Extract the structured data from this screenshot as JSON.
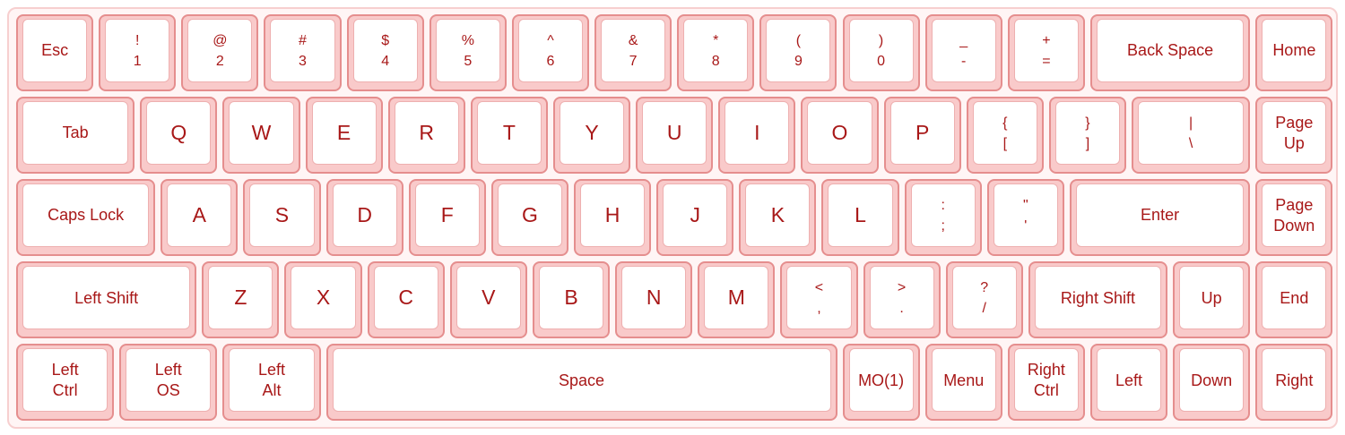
{
  "keyboard": {
    "rows": [
      [
        {
          "id": "esc",
          "lines": [
            "Esc"
          ],
          "w": 1
        },
        {
          "id": "1",
          "lines": [
            "!",
            "1"
          ],
          "w": 1
        },
        {
          "id": "2",
          "lines": [
            "@",
            "2"
          ],
          "w": 1
        },
        {
          "id": "3",
          "lines": [
            "#",
            "3"
          ],
          "w": 1
        },
        {
          "id": "4",
          "lines": [
            "$",
            "4"
          ],
          "w": 1
        },
        {
          "id": "5",
          "lines": [
            "%",
            "5"
          ],
          "w": 1
        },
        {
          "id": "6",
          "lines": [
            "^",
            "6"
          ],
          "w": 1
        },
        {
          "id": "7",
          "lines": [
            "&",
            "7"
          ],
          "w": 1
        },
        {
          "id": "8",
          "lines": [
            "*",
            "8"
          ],
          "w": 1
        },
        {
          "id": "9",
          "lines": [
            "(",
            "9"
          ],
          "w": 1
        },
        {
          "id": "0",
          "lines": [
            ")",
            "0"
          ],
          "w": 1
        },
        {
          "id": "minus",
          "lines": [
            "_",
            "-"
          ],
          "w": 1
        },
        {
          "id": "equals",
          "lines": [
            "+",
            "="
          ],
          "w": 1
        },
        {
          "id": "backspace",
          "lines": [
            "Back Space"
          ],
          "w": 2
        },
        {
          "id": "home",
          "lines": [
            "Home"
          ],
          "w": 1
        }
      ],
      [
        {
          "id": "tab",
          "lines": [
            "Tab"
          ],
          "w": 1.5
        },
        {
          "id": "q",
          "lines": [
            "Q"
          ],
          "w": 1
        },
        {
          "id": "w",
          "lines": [
            "W"
          ],
          "w": 1
        },
        {
          "id": "e",
          "lines": [
            "E"
          ],
          "w": 1
        },
        {
          "id": "r",
          "lines": [
            "R"
          ],
          "w": 1
        },
        {
          "id": "t",
          "lines": [
            "T"
          ],
          "w": 1
        },
        {
          "id": "y",
          "lines": [
            "Y"
          ],
          "w": 1
        },
        {
          "id": "u",
          "lines": [
            "U"
          ],
          "w": 1
        },
        {
          "id": "i",
          "lines": [
            "I"
          ],
          "w": 1
        },
        {
          "id": "o",
          "lines": [
            "O"
          ],
          "w": 1
        },
        {
          "id": "p",
          "lines": [
            "P"
          ],
          "w": 1
        },
        {
          "id": "lbracket",
          "lines": [
            "{",
            "["
          ],
          "w": 1
        },
        {
          "id": "rbracket",
          "lines": [
            "}",
            "]"
          ],
          "w": 1
        },
        {
          "id": "backslash",
          "lines": [
            "|",
            "\\"
          ],
          "w": 1.5
        },
        {
          "id": "pageup",
          "lines": [
            "Page",
            "Up"
          ],
          "w": 1
        }
      ],
      [
        {
          "id": "capslock",
          "lines": [
            "Caps Lock"
          ],
          "w": 1.75
        },
        {
          "id": "a",
          "lines": [
            "A"
          ],
          "w": 1
        },
        {
          "id": "s",
          "lines": [
            "S"
          ],
          "w": 1
        },
        {
          "id": "d",
          "lines": [
            "D"
          ],
          "w": 1
        },
        {
          "id": "f",
          "lines": [
            "F"
          ],
          "w": 1
        },
        {
          "id": "g",
          "lines": [
            "G"
          ],
          "w": 1
        },
        {
          "id": "h",
          "lines": [
            "H"
          ],
          "w": 1
        },
        {
          "id": "j",
          "lines": [
            "J"
          ],
          "w": 1
        },
        {
          "id": "k",
          "lines": [
            "K"
          ],
          "w": 1
        },
        {
          "id": "l",
          "lines": [
            "L"
          ],
          "w": 1
        },
        {
          "id": "semicolon",
          "lines": [
            ":",
            ";"
          ],
          "w": 1
        },
        {
          "id": "quote",
          "lines": [
            "\"",
            "'"
          ],
          "w": 1
        },
        {
          "id": "enter",
          "lines": [
            "Enter"
          ],
          "w": 2.25
        },
        {
          "id": "pagedown",
          "lines": [
            "Page",
            "Down"
          ],
          "w": 1
        }
      ],
      [
        {
          "id": "leftshift",
          "lines": [
            "Left Shift"
          ],
          "w": 2.25
        },
        {
          "id": "z",
          "lines": [
            "Z"
          ],
          "w": 1
        },
        {
          "id": "x",
          "lines": [
            "X"
          ],
          "w": 1
        },
        {
          "id": "c",
          "lines": [
            "C"
          ],
          "w": 1
        },
        {
          "id": "v",
          "lines": [
            "V"
          ],
          "w": 1
        },
        {
          "id": "b",
          "lines": [
            "B"
          ],
          "w": 1
        },
        {
          "id": "n",
          "lines": [
            "N"
          ],
          "w": 1
        },
        {
          "id": "m",
          "lines": [
            "M"
          ],
          "w": 1
        },
        {
          "id": "comma",
          "lines": [
            "<",
            ","
          ],
          "w": 1
        },
        {
          "id": "period",
          "lines": [
            ">",
            "."
          ],
          "w": 1
        },
        {
          "id": "slash",
          "lines": [
            "?",
            "/"
          ],
          "w": 1
        },
        {
          "id": "rightshift",
          "lines": [
            "Right Shift"
          ],
          "w": 1.75
        },
        {
          "id": "up",
          "lines": [
            "Up"
          ],
          "w": 1
        },
        {
          "id": "end",
          "lines": [
            "End"
          ],
          "w": 1
        }
      ],
      [
        {
          "id": "leftctrl",
          "lines": [
            "Left",
            "Ctrl"
          ],
          "w": 1.25
        },
        {
          "id": "leftos",
          "lines": [
            "Left",
            "OS"
          ],
          "w": 1.25
        },
        {
          "id": "leftalt",
          "lines": [
            "Left",
            "Alt"
          ],
          "w": 1.25
        },
        {
          "id": "space",
          "lines": [
            "Space"
          ],
          "w": 6.25
        },
        {
          "id": "mo1",
          "lines": [
            "MO(1)"
          ],
          "w": 1
        },
        {
          "id": "menu",
          "lines": [
            "Menu"
          ],
          "w": 1
        },
        {
          "id": "rightctrl",
          "lines": [
            "Right",
            "Ctrl"
          ],
          "w": 1
        },
        {
          "id": "left",
          "lines": [
            "Left"
          ],
          "w": 1
        },
        {
          "id": "down",
          "lines": [
            "Down"
          ],
          "w": 1
        },
        {
          "id": "right",
          "lines": [
            "Right"
          ],
          "w": 1
        }
      ]
    ]
  }
}
